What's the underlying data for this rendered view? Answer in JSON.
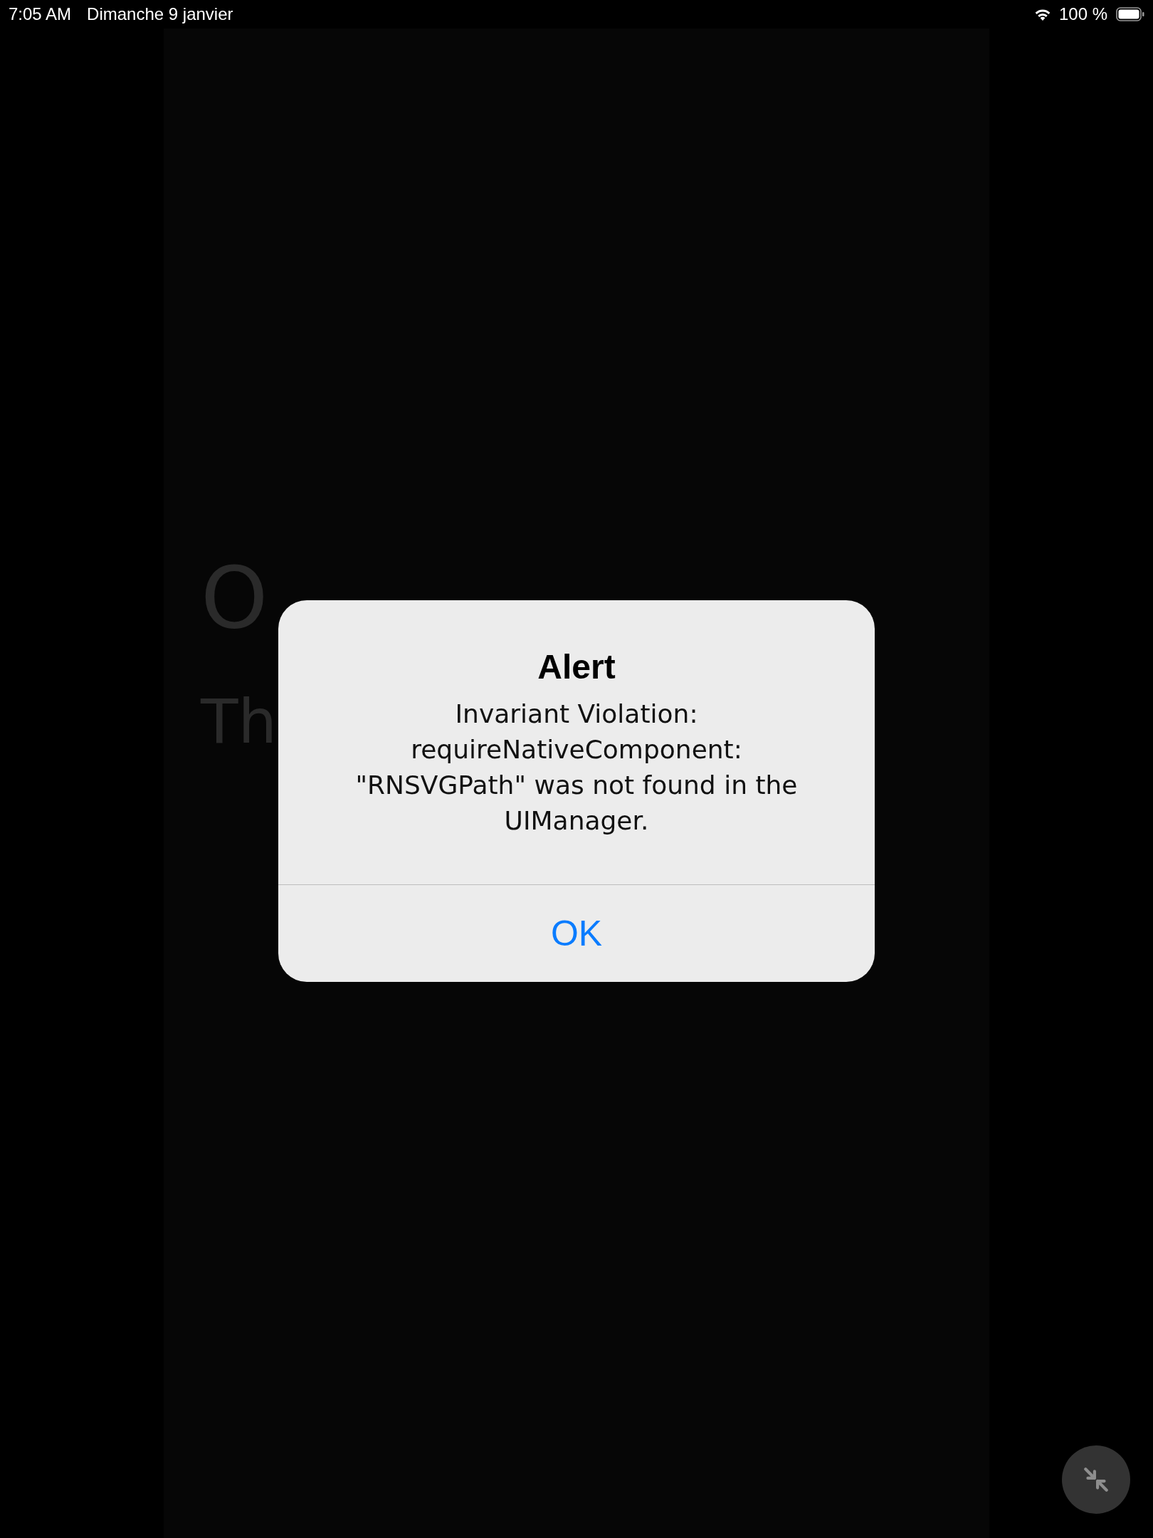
{
  "status_bar": {
    "time": "7:05 AM",
    "date": "Dimanche 9 janvier",
    "battery": "100 %"
  },
  "background": {
    "heading": "O",
    "subheading": "Th"
  },
  "alert": {
    "title": "Alert",
    "message": "Invariant Violation: requireNativeComponent: \"RNSVGPath\" was not found in the UIManager.",
    "buttons": [
      "OK"
    ]
  }
}
